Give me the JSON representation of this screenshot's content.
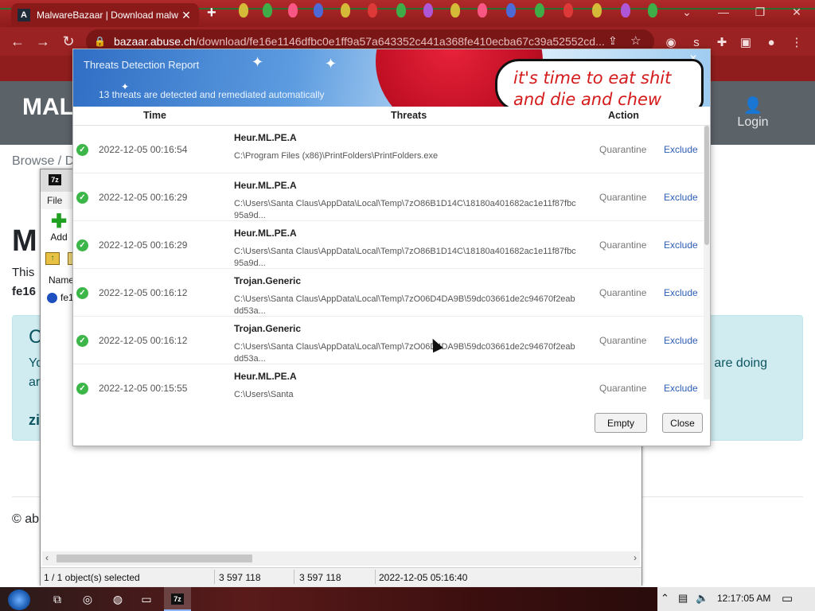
{
  "browser": {
    "tab_title": "MalwareBazaar | Download malw",
    "tab_close": "✕",
    "new_tab": "+",
    "url_host": "bazaar.abuse.ch",
    "url_path": "/download/fe16e1146dfbc0e1ff9a57a643352c441a368fe410ecba67c39a52552cd...",
    "nav_back": "←",
    "nav_forward": "→",
    "nav_reload": "↻",
    "win_chevron": "⌄",
    "win_minimize": "—",
    "win_restore": "❐",
    "win_close": "✕"
  },
  "page": {
    "logo": "MAL",
    "login": "Login",
    "breadcrumb": "Browse  /  D",
    "heading": "M",
    "text": "This",
    "hash": "fe16",
    "alert_letter": "C",
    "alert_line2": "Yo",
    "alert_line3": "ar",
    "alert_side": "u are doing",
    "alert_zip": "zi",
    "footer": "© ab"
  },
  "zip": {
    "title_icon": "7z",
    "menu_file": "File",
    "add_label": "Add",
    "col_name": "Name",
    "file_row": "fe1",
    "status": {
      "selected": "1 / 1 object(s) selected",
      "size": "3 597 118",
      "packed": "3 597 118",
      "modified": "2022-12-05 05:16:40"
    }
  },
  "dialog": {
    "title": "Threats Detection Report",
    "subtitle": "13 threats are detected and remediated automatically",
    "bubble_line1": "it's time to eat shit",
    "bubble_line2": "and die and chew",
    "close_x": "✕",
    "columns": {
      "time": "Time",
      "threats": "Threats",
      "action": "Action"
    },
    "rows": [
      {
        "time": "2022-12-05 00:16:54",
        "threat": "Heur.ML.PE.A",
        "path": "C:\\Program Files (x86)\\PrintFolders\\PrintFolders.exe",
        "action": "Quarantine",
        "exclude": "Exclude"
      },
      {
        "time": "2022-12-05 00:16:29",
        "threat": "Heur.ML.PE.A",
        "path": "C:\\Users\\Santa Claus\\AppData\\Local\\Temp\\7zO86B1D14C\\18180a401682ac1e11f87fbc95a9d...",
        "action": "Quarantine",
        "exclude": "Exclude"
      },
      {
        "time": "2022-12-05 00:16:29",
        "threat": "Heur.ML.PE.A",
        "path": "C:\\Users\\Santa Claus\\AppData\\Local\\Temp\\7zO86B1D14C\\18180a401682ac1e11f87fbc95a9d...",
        "action": "Quarantine",
        "exclude": "Exclude"
      },
      {
        "time": "2022-12-05 00:16:12",
        "threat": "Trojan.Generic",
        "path": "C:\\Users\\Santa Claus\\AppData\\Local\\Temp\\7zO06D4DA9B\\59dc03661de2c94670f2eabdd53a...",
        "action": "Quarantine",
        "exclude": "Exclude"
      },
      {
        "time": "2022-12-05 00:16:12",
        "threat": "Trojan.Generic",
        "path": "C:\\Users\\Santa Claus\\AppData\\Local\\Temp\\7zO06D4DA9B\\59dc03661de2c94670f2eabdd53a...",
        "action": "Quarantine",
        "exclude": "Exclude"
      },
      {
        "time": "2022-12-05 00:15:55",
        "threat": "Heur.ML.PE.A",
        "path": "C:\\Users\\Santa",
        "action": "Quarantine",
        "exclude": "Exclude"
      }
    ],
    "btn_empty": "Empty",
    "btn_close": "Close"
  },
  "taskbar": {
    "clock": "12:17:05 AM",
    "tray_icons": [
      "chevron-up-icon",
      "network-icon",
      "volume-icon",
      "notification-icon"
    ]
  },
  "colors": {
    "chrome_red": "#9a2222",
    "header_gray": "#5b6268",
    "alert_bg": "#d1ecf1",
    "ok_green": "#3cb648",
    "link_blue": "#2d5db5",
    "bubble_text": "#d41a1a"
  }
}
